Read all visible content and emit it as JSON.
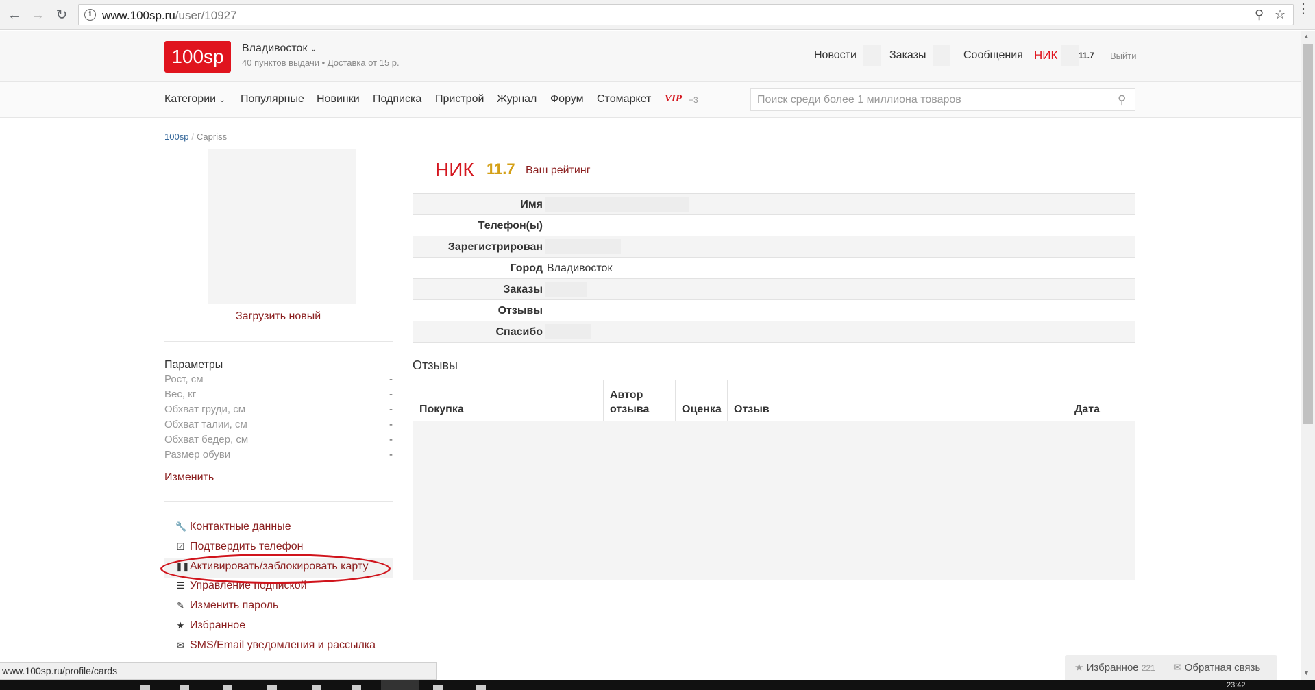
{
  "browser": {
    "url_host": "www.100sp.ru",
    "url_path": "/user/10927",
    "info_glyph": "i"
  },
  "header": {
    "logo": "100sp",
    "city": "Владивосток",
    "city_sub": "40 пунктов выдачи  •  Доставка от 15 р.",
    "nav_news": "Новости",
    "nav_orders": "Заказы",
    "nav_messages": "Сообщения",
    "nick": "НИК",
    "rating": "11.7",
    "logout": "Выйти"
  },
  "catbar": {
    "items": [
      "Категории",
      "Популярные",
      "Новинки",
      "Подписка",
      "Пристрой",
      "Журнал",
      "Форум",
      "Стомаркет"
    ],
    "vip": "VIP",
    "vip_count": "+3",
    "search_placeholder": "Поиск среди более 1 миллиона товаров"
  },
  "breadcrumb": {
    "root": "100sp",
    "current": "Capriss"
  },
  "left": {
    "upload_label": "Загрузить новый",
    "params_title": "Параметры",
    "params": [
      {
        "label": "Рост, см",
        "value": "-"
      },
      {
        "label": "Вес, кг",
        "value": "-"
      },
      {
        "label": "Обхват груди, см",
        "value": "-"
      },
      {
        "label": "Обхват талии, см",
        "value": "-"
      },
      {
        "label": "Обхват бедер, см",
        "value": "-"
      },
      {
        "label": "Размер обуви",
        "value": "-"
      }
    ],
    "edit_label": "Изменить",
    "menu": [
      {
        "label": "Контактные данные",
        "icon": "wrench-icon"
      },
      {
        "label": "Подтвердить телефон",
        "icon": "check-square-icon"
      },
      {
        "label": "Активировать/заблокировать карту",
        "icon": "barcode-icon"
      },
      {
        "label": "Управление подпиской",
        "icon": "list-icon"
      },
      {
        "label": "Изменить пароль",
        "icon": "pencil-icon"
      },
      {
        "label": "Избранное",
        "icon": "star-icon"
      },
      {
        "label": "SMS/Email уведомления и рассылка",
        "icon": "envelope-icon"
      }
    ],
    "highlight_color": "#d0141c"
  },
  "profile": {
    "nick": "НИК",
    "rating": "11.7",
    "rating_label": "Ваш рейтинг",
    "rows": [
      {
        "key": "Имя",
        "value": ""
      },
      {
        "key": "Телефон(ы)",
        "value": ""
      },
      {
        "key": "Зарегистрирован",
        "value": ""
      },
      {
        "key": "Город",
        "value": "Владивосток"
      },
      {
        "key": "Заказы",
        "value": ""
      },
      {
        "key": "Отзывы",
        "value": ""
      },
      {
        "key": "Спасибо",
        "value": ""
      }
    ]
  },
  "reviews": {
    "title": "Отзывы",
    "columns": [
      "Покупка",
      "Автор отзыва",
      "Оценка",
      "Отзыв",
      "Дата"
    ]
  },
  "widgets": {
    "favorites_label": "Избранное",
    "favorites_count": "221",
    "feedback_label": "Обратная связь",
    "status_url": "www.100sp.ru/profile/cards",
    "clock": "23:42"
  },
  "colors": {
    "brand_red": "#e0141e",
    "link_maroon": "#8b1f1f",
    "rating_gold": "#d4a017"
  }
}
